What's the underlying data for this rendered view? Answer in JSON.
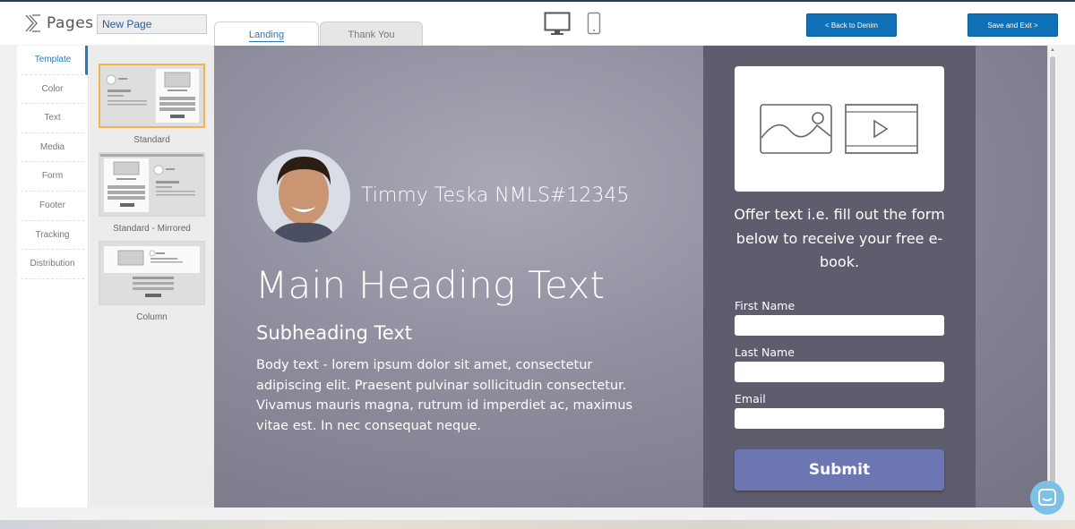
{
  "app": {
    "logo_text": "Pages"
  },
  "header": {
    "page_name": "New Page",
    "tabs": [
      {
        "label": "Landing"
      },
      {
        "label": "Thank You"
      }
    ],
    "back_label": "<  Back to Denim",
    "save_label": "Save and Exit   >"
  },
  "sidebar": {
    "items": [
      {
        "label": "Template"
      },
      {
        "label": "Color"
      },
      {
        "label": "Text"
      },
      {
        "label": "Media"
      },
      {
        "label": "Form"
      },
      {
        "label": "Footer"
      },
      {
        "label": "Tracking"
      },
      {
        "label": "Distribution"
      }
    ],
    "active": "Template"
  },
  "templates": [
    {
      "label": "Standard",
      "selected": true
    },
    {
      "label": "Standard - Mirrored",
      "selected": false
    },
    {
      "label": "Column",
      "selected": false
    }
  ],
  "landing": {
    "name_line": "Timmy Teska NMLS#12345",
    "main_heading": "Main Heading Text",
    "subheading": "Subheading Text",
    "body": "Body text - lorem ipsum dolor sit amet, consectetur adipiscing elit. Praesent pulvinar sollicitudin consectetur. Vivamus mauris magna, rutrum id imperdiet ac, maximus vitae est. In nec consequat neque.",
    "offer": "Offer text i.e. fill out the form below to receive your free e-book.",
    "fields": [
      {
        "label": "First Name"
      },
      {
        "label": "Last Name"
      },
      {
        "label": "Email"
      }
    ],
    "submit_label": "Submit"
  },
  "colors": {
    "accent": "#0f70b7",
    "submit": "#6c76b2",
    "selected_template": "#f0b44c",
    "panel": "#5d5d6d"
  }
}
